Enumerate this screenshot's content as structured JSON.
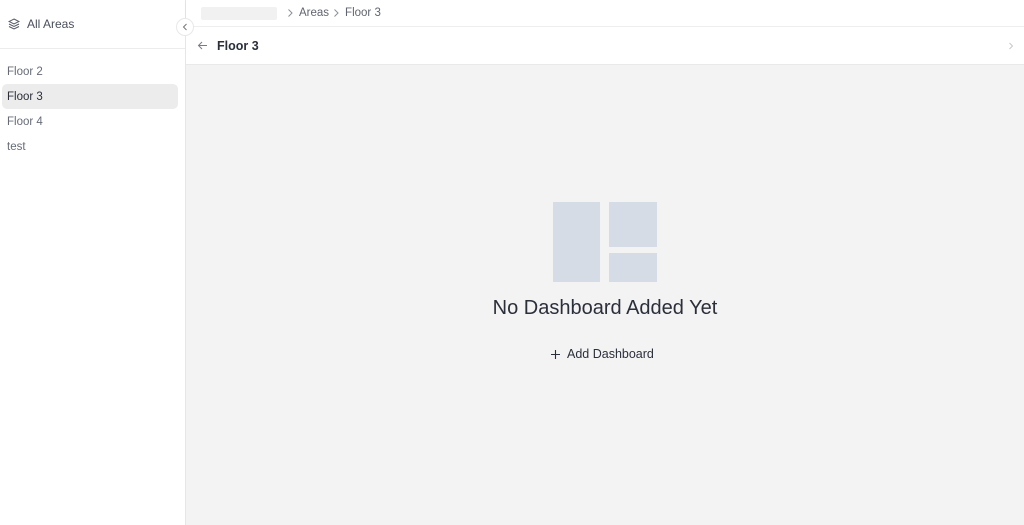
{
  "sidebar": {
    "title": "All Areas",
    "items": [
      {
        "label": "Floor 2",
        "active": false
      },
      {
        "label": "Floor 3",
        "active": true
      },
      {
        "label": "Floor 4",
        "active": false
      },
      {
        "label": "test",
        "active": false
      }
    ]
  },
  "breadcrumb": {
    "items": [
      "Areas",
      "Floor 3"
    ]
  },
  "header": {
    "title": "Floor 3"
  },
  "empty_state": {
    "title": "No Dashboard Added Yet",
    "add_label": "Add Dashboard"
  },
  "icons": {
    "sidebar": "layers-icon",
    "collapse": "chevron-left-icon",
    "breadcrumb_separator": "chevron-right-icon",
    "back": "arrow-left-icon",
    "add": "plus-icon",
    "empty": "dashboard-layout-icon"
  },
  "colors": {
    "background": "#f3f3f3",
    "active_item": "#ececec",
    "placeholder_blocks": "#d6dce5",
    "text": "#2b2f3a"
  }
}
